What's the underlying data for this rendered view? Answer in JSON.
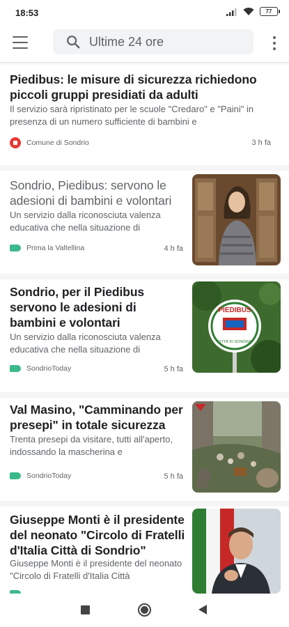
{
  "status_bar": {
    "time": "18:53",
    "battery": "77"
  },
  "search": {
    "text": "Ultime 24 ore"
  },
  "articles": [
    {
      "title": "Piedibus: le misure di sicurezza richiedono piccoli gruppi presidiati da adulti",
      "snippet": "Il servizio sarà ripristinato per le scuole \"Credaro\" e \"Paini\" in presenza di un numero sufficiente di bambini e",
      "source": "Comune di Sondrio",
      "time": "3 h fa"
    },
    {
      "title": "Sondrio, Piedibus: servono le adesioni di bambini e volontari",
      "snippet": "Un servizio dalla riconosciuta valenza educativa che nella situazione di",
      "source": "Prima la Valtellina",
      "time": "4 h fa"
    },
    {
      "title": "Sondrio, per il Piedibus servono le adesioni di bambini e volontari",
      "snippet": "Un servizio dalla riconosciuta valenza educativa che nella situazione di",
      "source": "SondrioToday",
      "time": "5 h fa",
      "sign_text": "PIEDIBUS",
      "sign_sub": "CITTÀ DI SONDRIO"
    },
    {
      "title": "Val Masino, \"Camminando per presepi\" in totale sicurezza",
      "snippet": "Trenta presepi da visitare, tutti all'aperto, indossando la mascherina e",
      "source": "SondrioToday",
      "time": "5 h fa"
    },
    {
      "title": "Giuseppe Monti è il presidente del neonato \"Circolo di Fratelli d'Italia Città di Sondrio\"",
      "snippet": "Giuseppe Monti è il presidente del neonato \"Circolo di Fratelli d'Italia Città",
      "source": "",
      "time": ""
    }
  ],
  "colors": {
    "accent_tag": "#3cb98a",
    "source_logo": "#e53935",
    "title": "#202124",
    "secondary": "#5f6368"
  },
  "icons": [
    "menu-icon",
    "search-icon",
    "more-vert-icon",
    "wifi-icon",
    "signal-icon",
    "battery-icon",
    "recents-icon",
    "home-icon",
    "back-icon"
  ]
}
